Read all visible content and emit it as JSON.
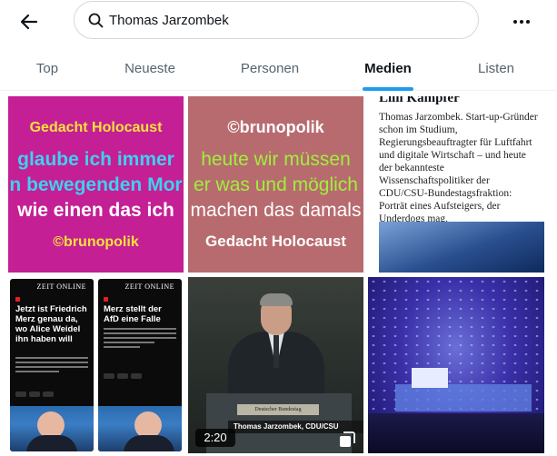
{
  "search": {
    "value": "Thomas Jarzombek"
  },
  "tabs": [
    {
      "label": "Top"
    },
    {
      "label": "Neueste"
    },
    {
      "label": "Personen"
    },
    {
      "label": "Medien"
    },
    {
      "label": "Listen"
    }
  ],
  "active_tab": "Medien",
  "colors": {
    "accent": "#1d9bf0",
    "text": "#0f1419",
    "muted": "#536471"
  },
  "media": {
    "tile1": {
      "line1": "Gedacht Holocaust",
      "line2": "glaube ich immer",
      "line3": "n bewegenden Mor",
      "line4": "wie einen das ich",
      "line5": "©brunopolik"
    },
    "tile2": {
      "line1": "©brunopolik",
      "line2": "heute wir müssen",
      "line3": "er was und möglich",
      "line4": "machen das damals",
      "line5": "Gedacht Holocaust"
    },
    "tile3": {
      "title": "Lilli Kampfer",
      "body": "Thomas Jarzombek. Start-up-Gründer schon im Studium, Regierungsbeauftragter für Luftfahrt und digitale Wirtschaft – und heute der bekannteste Wissenschaftspolitiker der CDU/CSU-Bundestagsfraktion: Porträt eines Aufsteigers, der Underdogs mag."
    },
    "tile4": {
      "logo_a": "ZEIT ONLINE",
      "head_a": "Jetzt ist Friedrich Merz genau da, wo Alice Weidel ihn haben will",
      "logo_b": "ZEIT ONLINE",
      "head_b": "Merz stellt der AfD eine Falle"
    },
    "tile5": {
      "plate": "Deutscher Bundestag",
      "chyron": "Thomas Jarzombek, CDU/CSU",
      "duration": "2:20"
    }
  }
}
